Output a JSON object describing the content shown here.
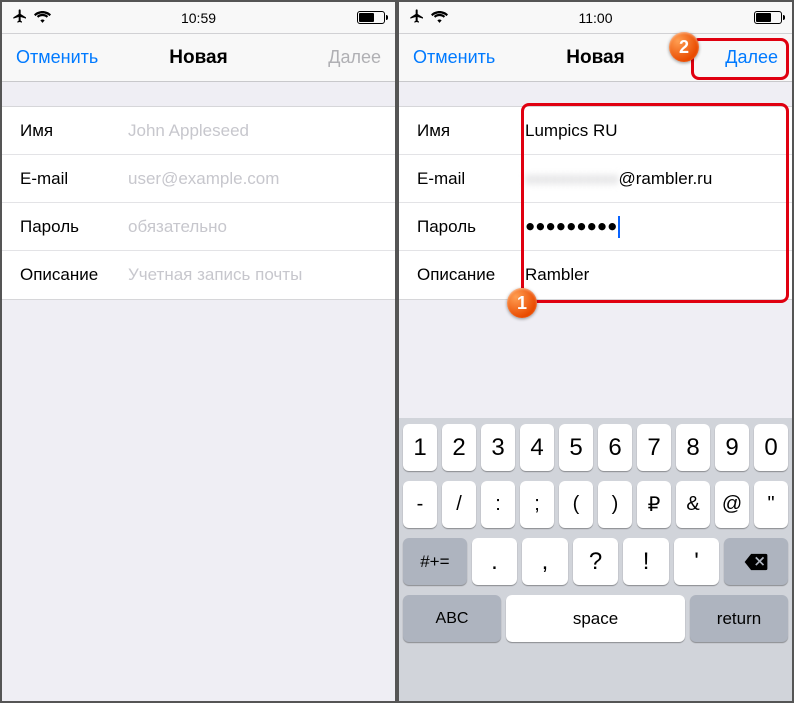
{
  "left": {
    "statusbar": {
      "time": "10:59"
    },
    "nav": {
      "cancel": "Отменить",
      "title": "Новая",
      "next": "Далее"
    },
    "fields": {
      "name": {
        "label": "Имя",
        "placeholder": "John Appleseed"
      },
      "email": {
        "label": "E-mail",
        "placeholder": "user@example.com"
      },
      "password": {
        "label": "Пароль",
        "placeholder": "обязательно"
      },
      "desc": {
        "label": "Описание",
        "placeholder": "Учетная запись почты"
      }
    }
  },
  "right": {
    "statusbar": {
      "time": "11:00"
    },
    "nav": {
      "cancel": "Отменить",
      "title": "Новая",
      "next": "Далее"
    },
    "fields": {
      "name": {
        "label": "Имя",
        "value": "Lumpics RU"
      },
      "email": {
        "label": "E-mail",
        "value_suffix": "@rambler.ru"
      },
      "password": {
        "label": "Пароль",
        "value": "●●●●●●●●●"
      },
      "desc": {
        "label": "Описание",
        "value": "Rambler"
      }
    },
    "keyboard": {
      "row1": [
        "1",
        "2",
        "3",
        "4",
        "5",
        "6",
        "7",
        "8",
        "9",
        "0"
      ],
      "row2": [
        "-",
        "/",
        ":",
        ";",
        "(",
        ")",
        "₽",
        "&",
        "@",
        "\""
      ],
      "row3_shift": "#+=",
      "row3": [
        ".",
        ",",
        "?",
        "!",
        "'"
      ],
      "abc": "ABC",
      "space": "space",
      "return": "return"
    }
  },
  "badges": {
    "one": "1",
    "two": "2"
  }
}
